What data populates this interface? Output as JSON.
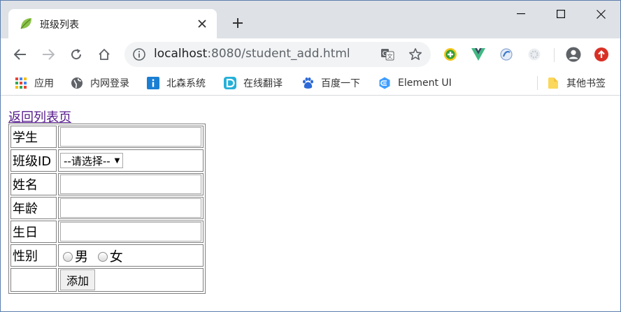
{
  "browser": {
    "tab": {
      "title": "班级列表"
    },
    "url": {
      "host": "localhost",
      "rest": ":8080/student_add.html"
    },
    "bookmarks": [
      {
        "label": "应用",
        "icon": "apps-grid-icon"
      },
      {
        "label": "内网登录",
        "icon": "globe-icon"
      },
      {
        "label": "北森系统",
        "icon": "info-tile-icon"
      },
      {
        "label": "在线翻译",
        "icon": "translate-tile-icon"
      },
      {
        "label": "百度一下",
        "icon": "baidu-paw-icon"
      },
      {
        "label": "Element UI",
        "icon": "element-logo-icon"
      }
    ],
    "other_bookmarks": "其他书签"
  },
  "page": {
    "back_link": "返回列表页",
    "form": {
      "student_label": "学生",
      "class_id_label": "班级ID",
      "class_select_value": "--请选择--",
      "name_label": "姓名",
      "age_label": "年龄",
      "birthday_label": "生日",
      "gender_label": "性别",
      "gender_male": "男",
      "gender_female": "女",
      "submit_label": "添加"
    }
  },
  "colors": {
    "link_visited": "#551a8b",
    "tabstrip": "#dee1e6",
    "window_border": "#5b7fae"
  }
}
